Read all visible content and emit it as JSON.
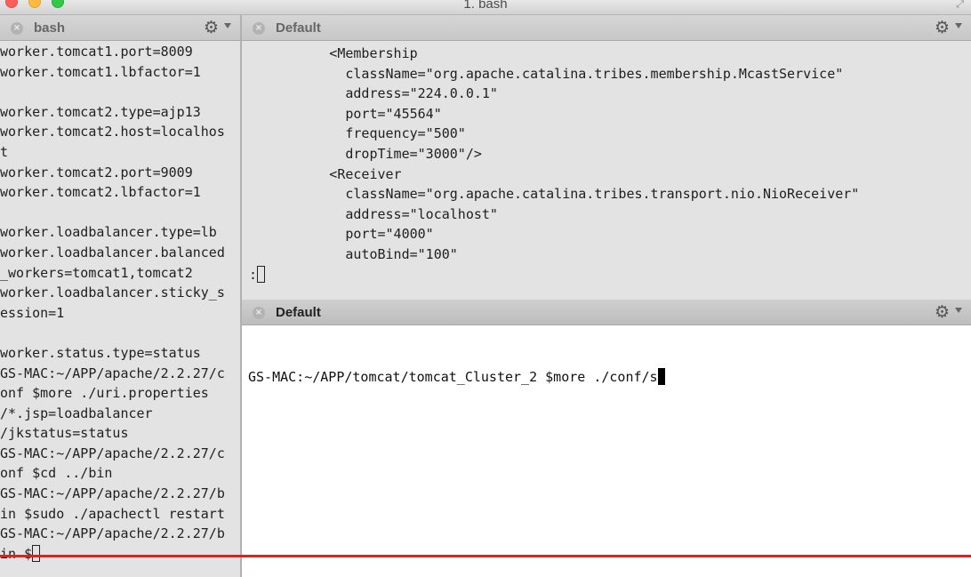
{
  "window": {
    "title": "1. bash",
    "progress_fraction": 1.0,
    "colors": {
      "progress": "#e01f1f",
      "close_red": "#fc605c",
      "minimize_yellow": "#fdbc40",
      "zoom_green": "#34c84a"
    }
  },
  "panes": {
    "left": {
      "title": "bash",
      "lines": [
        "worker.tomcat1.port=8009",
        "worker.tomcat1.lbfactor=1",
        "",
        "worker.tomcat2.type=ajp13",
        "worker.tomcat2.host=localhos",
        "t",
        "worker.tomcat2.port=9009",
        "worker.tomcat2.lbfactor=1",
        "",
        "worker.loadbalancer.type=lb",
        "worker.loadbalancer.balanced",
        "_workers=tomcat1,tomcat2",
        "worker.loadbalancer.sticky_s",
        "ession=1",
        "",
        "worker.status.type=status",
        "GS-MAC:~/APP/apache/2.2.27/c",
        "onf $more ./uri.properties",
        "/*.jsp=loadbalancer",
        "/jkstatus=status",
        "GS-MAC:~/APP/apache/2.2.27/c",
        "onf $cd ../bin",
        "GS-MAC:~/APP/apache/2.2.27/b",
        "in $sudo ./apachectl restart",
        "GS-MAC:~/APP/apache/2.2.27/b"
      ],
      "prompt_line": "in $"
    },
    "top": {
      "title": "Default",
      "lines": [
        "          <Membership",
        "            className=\"org.apache.catalina.tribes.membership.McastService\"",
        "            address=\"224.0.0.1\"",
        "            port=\"45564\"",
        "            frequency=\"500\"",
        "            dropTime=\"3000\"/>",
        "          <Receiver",
        "            className=\"org.apache.catalina.tribes.transport.nio.NioReceiver\"",
        "            address=\"localhost\"",
        "            port=\"4000\"",
        "            autoBind=\"100\""
      ],
      "prompt_line": ":"
    },
    "bottom": {
      "title": "Default",
      "command_line": "GS-MAC:~/APP/tomcat/tomcat_Cluster_2 $more ./conf/s"
    }
  },
  "icons": {
    "close": "close-circle-icon",
    "settings": "gear-icon",
    "menu": "chevron-down-icon"
  }
}
